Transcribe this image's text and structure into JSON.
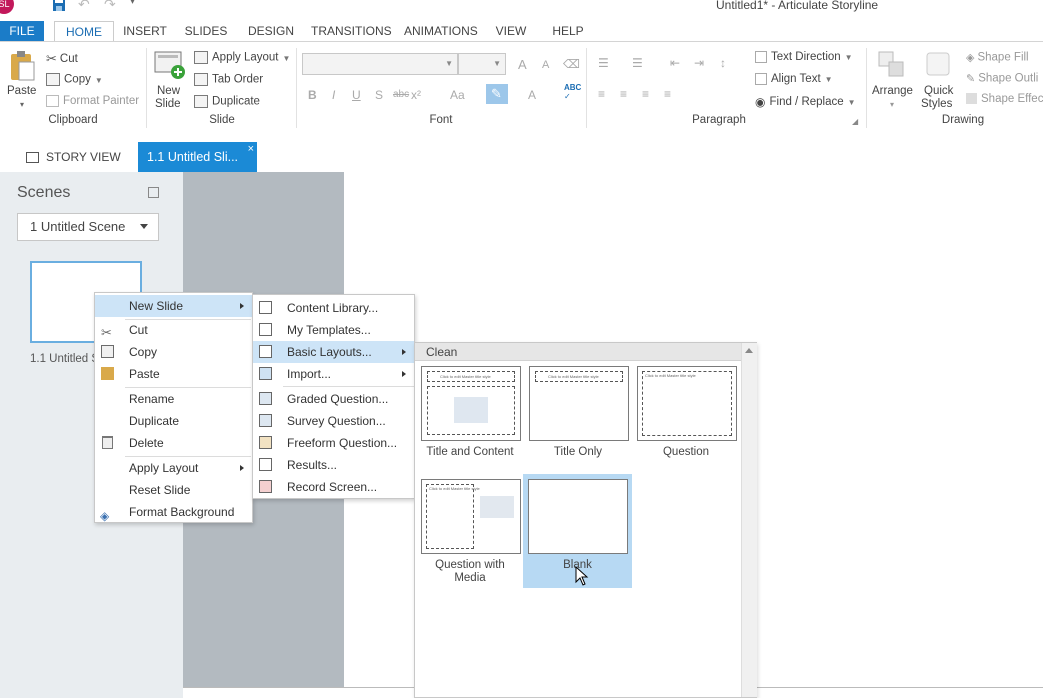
{
  "window": {
    "title": "Untitled1* - Articulate Storyline",
    "logo_text": "SL",
    "undo_glyph": "↶",
    "redo_glyph": "↷",
    "more_glyph": "▾"
  },
  "ribbon_tabs": [
    "FILE",
    "HOME",
    "INSERT",
    "SLIDES",
    "DESIGN",
    "TRANSITIONS",
    "ANIMATIONS",
    "VIEW",
    "HELP"
  ],
  "ribbon": {
    "clipboard": {
      "paste": "Paste",
      "cut": "Cut",
      "copy": "Copy",
      "format_painter": "Format Painter",
      "label": "Clipboard"
    },
    "slide": {
      "new_slide_1": "New",
      "new_slide_2": "Slide",
      "apply_layout": "Apply Layout",
      "tab_order": "Tab Order",
      "duplicate": "Duplicate",
      "label": "Slide"
    },
    "font": {
      "label": "Font",
      "bold": "B",
      "italic": "I",
      "underline": "U",
      "shadow": "S",
      "strike": "abc",
      "case": "Aa",
      "color": "A",
      "grow": "A",
      "shrink": "A"
    },
    "paragraph": {
      "text_direction": "Text Direction",
      "align_text": "Align Text",
      "find_replace": "Find / Replace",
      "label": "Paragraph"
    },
    "drawing": {
      "arrange": "Arrange",
      "quick_styles_1": "Quick",
      "quick_styles_2": "Styles",
      "shape_fill": "Shape Fill",
      "shape_outline": "Shape Outli",
      "shape_effects": "Shape Effec",
      "label": "Drawing"
    }
  },
  "doc_tabs": {
    "story_view": "STORY VIEW",
    "slide_tab": "1.1 Untitled Sli...",
    "close": "×"
  },
  "scenes": {
    "title": "Scenes",
    "dropdown_value": "1 Untitled Scene",
    "slide_label": "1.1 Untitled S"
  },
  "context_menu": {
    "new_slide": "New Slide",
    "cut": "Cut",
    "copy": "Copy",
    "paste": "Paste",
    "rename": "Rename",
    "duplicate": "Duplicate",
    "delete": "Delete",
    "apply_layout": "Apply Layout",
    "reset_slide": "Reset Slide",
    "format_background": "Format Background"
  },
  "submenu": {
    "content_library": "Content Library...",
    "my_templates": "My Templates...",
    "basic_layouts": "Basic Layouts...",
    "import": "Import...",
    "graded_question": "Graded Question...",
    "survey_question": "Survey Question...",
    "freeform_question": "Freeform Question...",
    "results": "Results...",
    "record_screen": "Record Screen..."
  },
  "gallery": {
    "header": "Clean",
    "placeholder_text": "Click to edit Master title style",
    "layouts": [
      {
        "line1": "Title and Content",
        "line2": ""
      },
      {
        "line1": "Title Only",
        "line2": ""
      },
      {
        "line1": "Question",
        "line2": ""
      },
      {
        "line1": "Question with",
        "line2": "Media"
      },
      {
        "line1": "Blank",
        "line2": ""
      }
    ]
  }
}
